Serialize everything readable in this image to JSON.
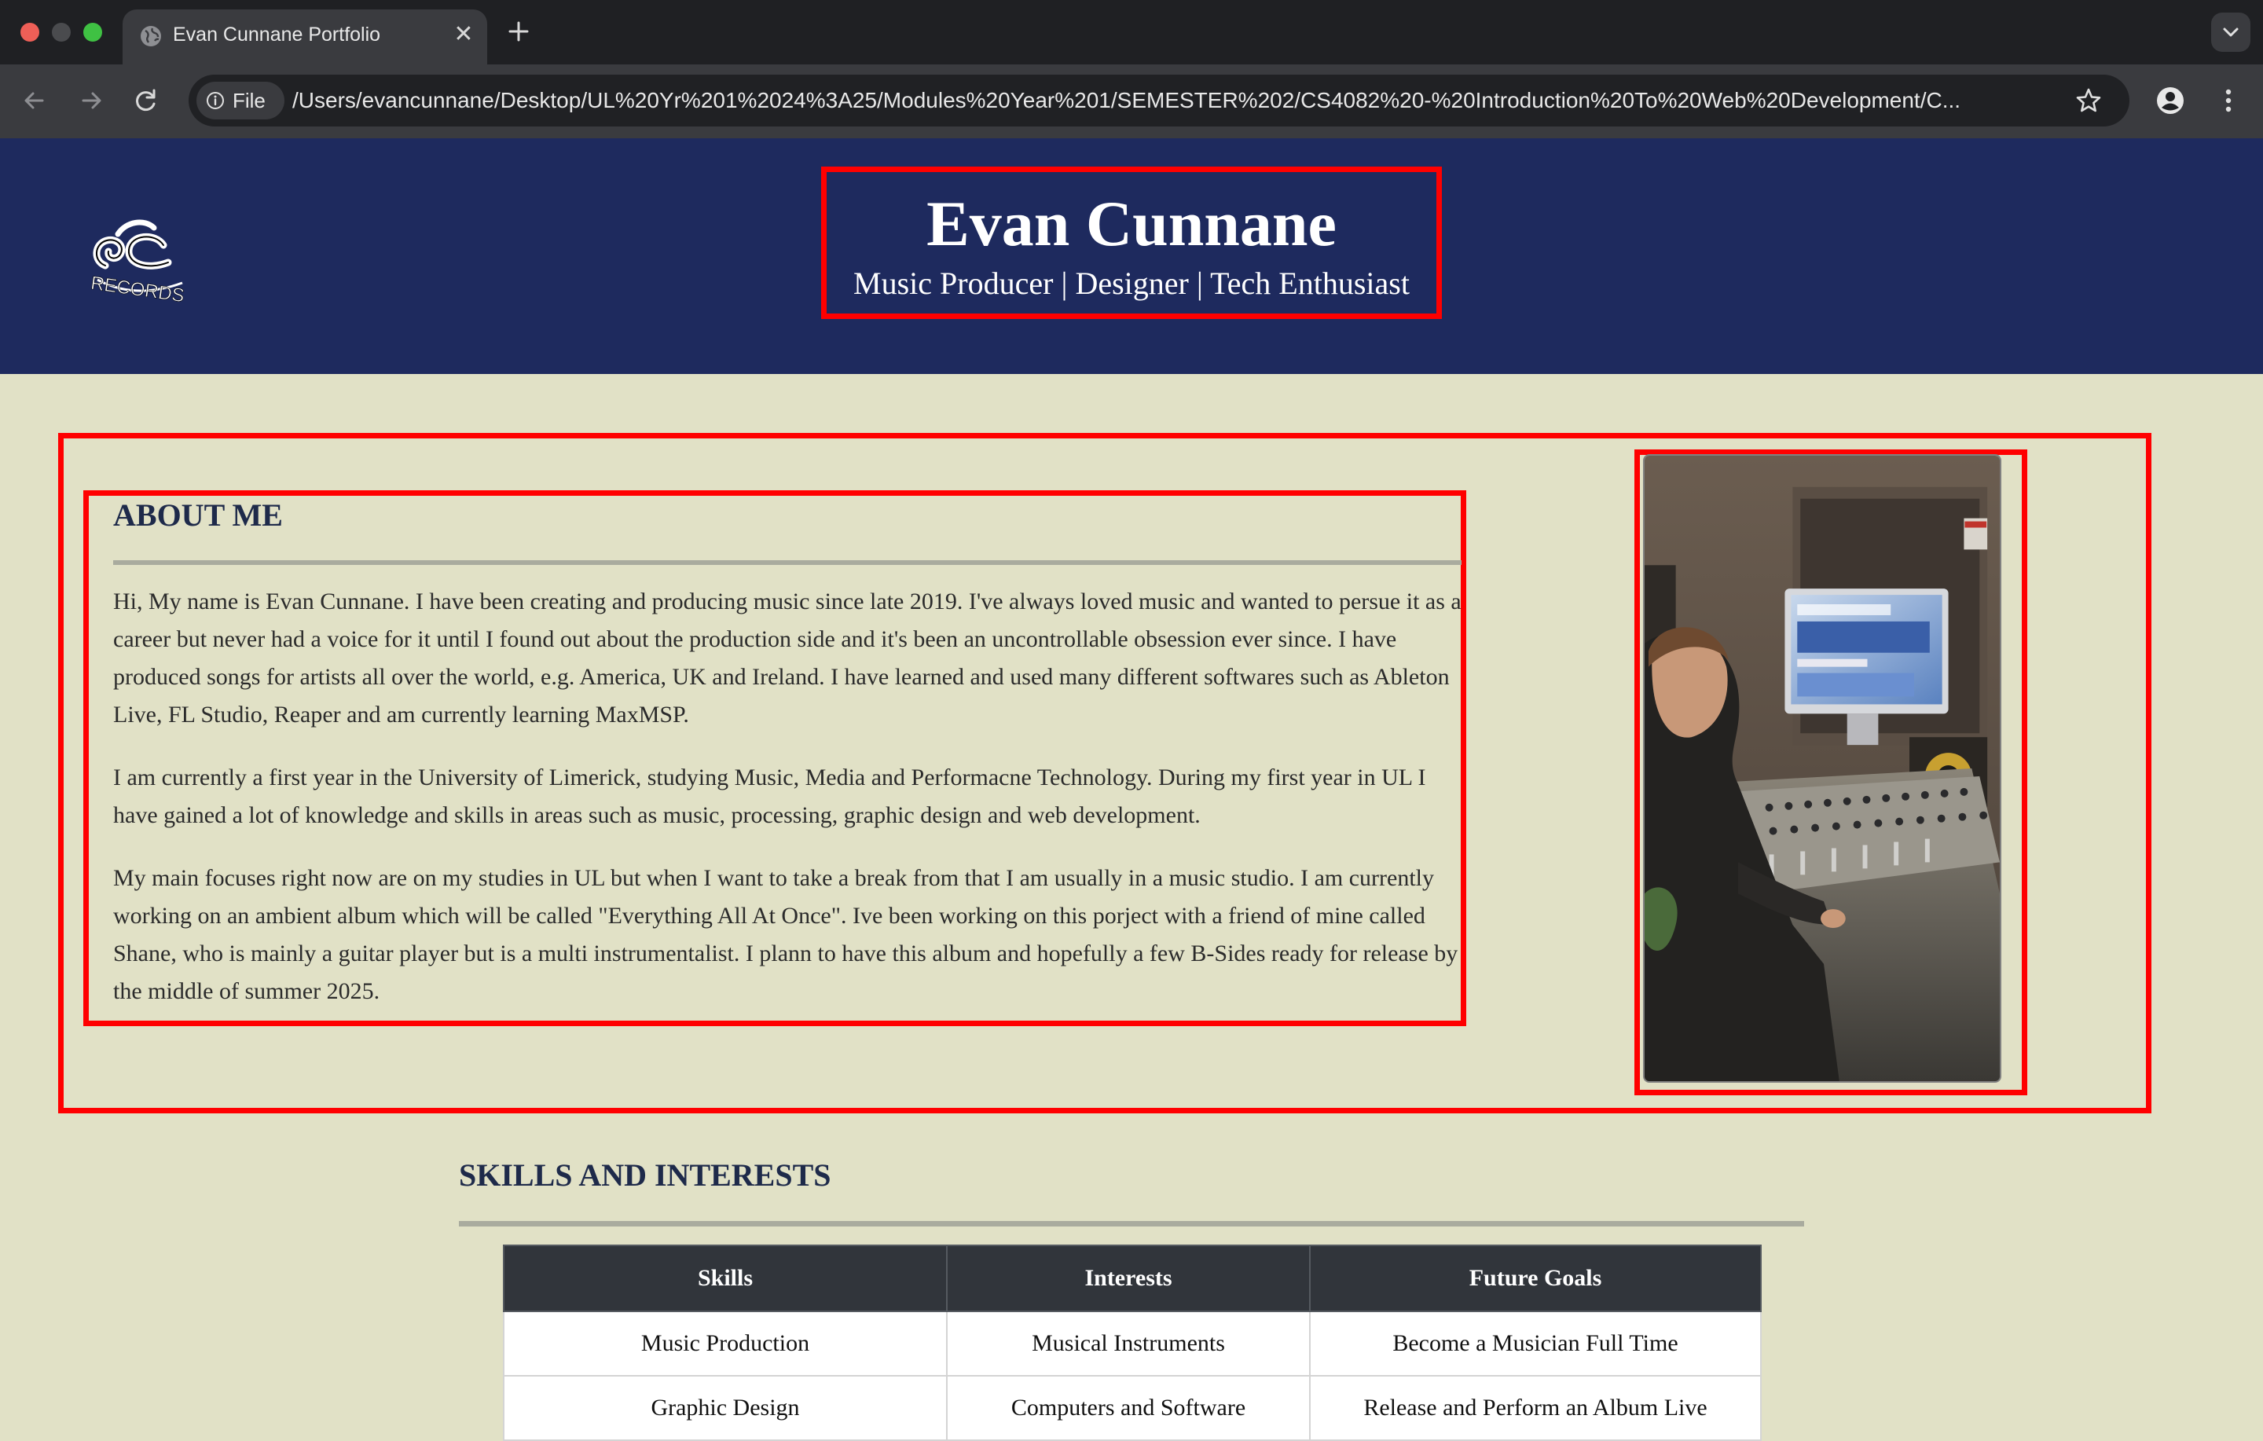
{
  "browser": {
    "tab_title": "Evan Cunnane Portfolio",
    "close_glyph": "✕",
    "file_chip_label": "File",
    "url": "/Users/evancunnane/Desktop/UL%20Yr%201%2024%3A25/Modules%20Year%201/SEMESTER%202/CS4082%20-%20Introduction%20To%20Web%20Development/C...",
    "icons": [
      "globe-icon",
      "plus-icon",
      "chevron-down-icon",
      "back-arrow-icon",
      "forward-arrow-icon",
      "reload-icon",
      "info-icon",
      "star-icon",
      "profile-icon",
      "more-vert-icon"
    ],
    "traffic_light_colors": {
      "close": "#ee5f57",
      "minimize": "#4a4b4e",
      "maximize": "#3fc143"
    }
  },
  "header": {
    "title": "Evan Cunnane",
    "tagline": "Music Producer | Designer | Tech Enthusiast",
    "logo_text": "RECORDS",
    "background_color": "#1e2a5e"
  },
  "about": {
    "heading": "ABOUT ME",
    "paragraphs": [
      "Hi, My name is Evan Cunnane. I have been creating and producing music since late 2019. I've always loved music and wanted to persue it as a career but never had a voice for it until I found out about the production side and it's been an uncontrollable obsession ever since. I have produced songs for artists all over the world, e.g. America, UK and Ireland. I have learned and used many different softwares such as Ableton Live, FL Studio, Reaper and am currently learning MaxMSP.",
      "I am currently a first year in the University of Limerick, studying Music, Media and Performacne Technology. During my first year in UL I have gained a lot of knowledge and skills in areas such as music, processing, graphic design and web development.",
      "My main focuses right now are on my studies in UL but when I want to take a break from that I am usually in a music studio. I am currently working on an ambient album which will be called \"Everything All At Once\". Ive been working on this porject with a friend of mine called Shane, who is mainly a guitar player but is a multi instrumentalist. I plann to have this album and hopefully a few B-Sides ready for release by the middle of summer 2025."
    ],
    "photo_icon": "studio-photo"
  },
  "skills": {
    "heading": "SKILLS AND INTERESTS",
    "columns": [
      "Skills",
      "Interests",
      "Future Goals"
    ],
    "rows": [
      [
        "Music Production",
        "Musical Instruments",
        "Become a Musician Full Time"
      ],
      [
        "Graphic Design",
        "Computers and Software",
        "Release and Perform an Album Live"
      ]
    ]
  },
  "colors": {
    "page_background": "#e1e1c6",
    "annotation_red": "#ff0000",
    "heading_navy": "#1e2a4a",
    "table_header": "#31353b"
  }
}
